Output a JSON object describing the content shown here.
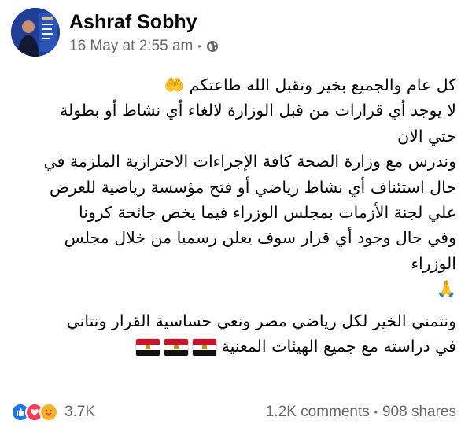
{
  "post": {
    "author": "Ashraf Sobhy",
    "timestamp": "16 May at 2:55 am",
    "separator": "•",
    "privacy_icon": "globe-icon"
  },
  "body": {
    "lines": [
      "كل عام والجميع بخير وتقبل الله طاعتكم 🤲",
      "لا يوجد أي قرارات من قبل الوزارة لالغاء أي نشاط أو بطولة",
      "حتي الان",
      "وندرس مع وزارة الصحة كافة الإجراءات الاحترازية الملزمة في",
      "حال استئناف أي نشاط رياضي أو فتح مؤسسة رياضية للعرض",
      "علي لجنة الأزمات بمجلس الوزراء فيما يخص جائحة كرونا",
      "وفي حال وجود أي قرار سوف يعلن رسميا من خلال  مجلس",
      "الوزراء",
      "🙏",
      "ونتمني الخير لكل رياضي مصر ونعي حساسية القرار ونتاني",
      "في دراسته مع جميع الهيئات المعنية"
    ],
    "flags_emoji": "🇪🇬🇪🇬🇪🇬"
  },
  "footer": {
    "reaction_icons": [
      "like-icon",
      "love-icon",
      "care-icon"
    ],
    "reaction_count": "3.7K",
    "comments": "1.2K comments",
    "separator": "•",
    "shares": "908 shares"
  }
}
